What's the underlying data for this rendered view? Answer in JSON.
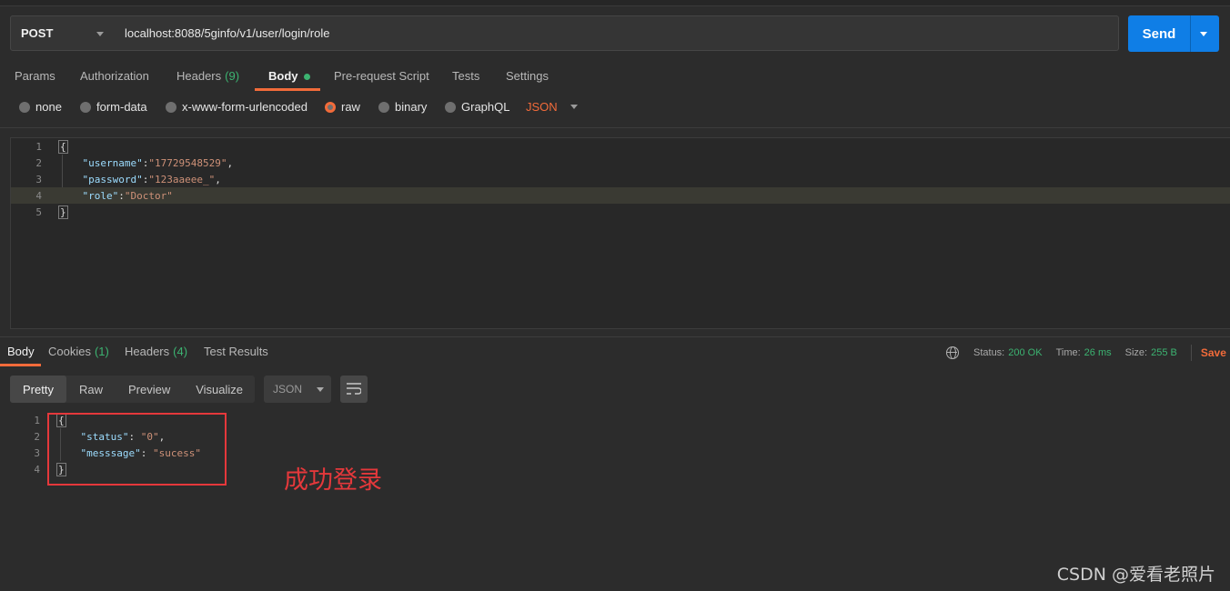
{
  "request": {
    "method": "POST",
    "url": "localhost:8088/5ginfo/v1/user/login/role",
    "send_label": "Send"
  },
  "request_tabs": [
    {
      "label": "Params"
    },
    {
      "label": "Authorization"
    },
    {
      "label": "Headers",
      "count": "(9)"
    },
    {
      "label": "Body"
    },
    {
      "label": "Pre-request Script"
    },
    {
      "label": "Tests"
    },
    {
      "label": "Settings"
    }
  ],
  "body_types": [
    "none",
    "form-data",
    "x-www-form-urlencoded",
    "raw",
    "binary",
    "GraphQL"
  ],
  "body_format": "JSON",
  "request_body": {
    "line_numbers": [
      "1",
      "2",
      "3",
      "4",
      "5"
    ],
    "open": "{",
    "close": "}",
    "fields": [
      {
        "key": "\"username\"",
        "sep": ":",
        "value": "\"17729548529\"",
        "trail": ","
      },
      {
        "key": "\"password\"",
        "sep": ":",
        "value": "\"123aaeee_\"",
        "trail": ","
      },
      {
        "key": "\"role\"",
        "sep": ":",
        "value": "\"Doctor\"",
        "trail": ""
      }
    ]
  },
  "response_tabs": [
    {
      "label": "Body"
    },
    {
      "label": "Cookies",
      "count": "(1)"
    },
    {
      "label": "Headers",
      "count": "(4)"
    },
    {
      "label": "Test Results"
    }
  ],
  "response_status": {
    "status_label": "Status:",
    "status_value": "200 OK",
    "time_label": "Time:",
    "time_value": "26 ms",
    "size_label": "Size:",
    "size_value": "255 B",
    "save_label": "Save"
  },
  "view_modes": [
    "Pretty",
    "Raw",
    "Preview",
    "Visualize"
  ],
  "response_format": "JSON",
  "response_body": {
    "line_numbers": [
      "1",
      "2",
      "3",
      "4"
    ],
    "open": "{",
    "close": "}",
    "fields": [
      {
        "key": "\"status\"",
        "sep": ": ",
        "value": "\"0\"",
        "trail": ","
      },
      {
        "key": "\"messsage\"",
        "sep": ": ",
        "value": "\"sucess\"",
        "trail": ""
      }
    ]
  },
  "annotation": "成功登录",
  "watermark": "CSDN @爱看老照片",
  "colors": {
    "accent": "#f26b3a",
    "send_button": "#0f7ee6",
    "success": "#3cb371",
    "annotation_red": "#e5383b"
  },
  "icons": {
    "method_dropdown": "chevron-down-icon",
    "send_dropdown": "chevron-down-icon",
    "globe": "globe-icon",
    "wrap": "wrap-lines-icon"
  }
}
